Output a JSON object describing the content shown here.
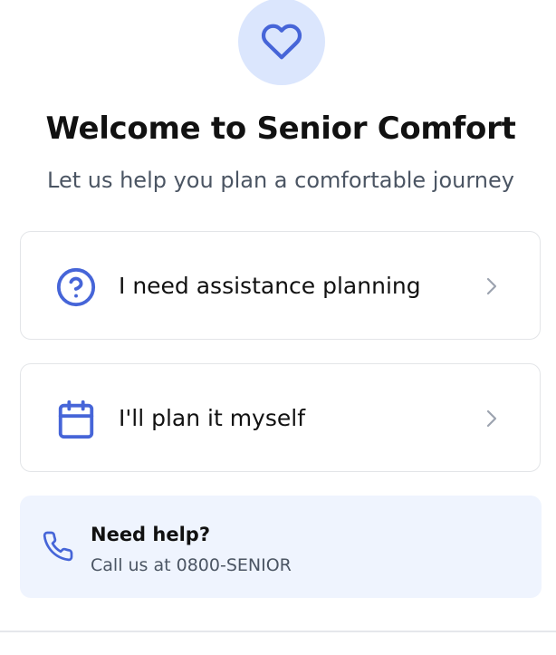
{
  "header": {
    "icon": "heart-icon",
    "title": "Welcome to Senior Comfort",
    "subtitle": "Let us help you plan a comfortable journey"
  },
  "options": [
    {
      "icon": "question-circle-icon",
      "label": "I need assistance planning",
      "chevron": "chevron-right-icon"
    },
    {
      "icon": "calendar-icon",
      "label": "I'll plan it myself",
      "chevron": "chevron-right-icon"
    }
  ],
  "help": {
    "icon": "phone-icon",
    "title": "Need help?",
    "text": "Call us at 0800-SENIOR"
  },
  "colors": {
    "accent": "#4665d8",
    "badge_bg": "#dbe6fd",
    "help_bg": "#eff4fe",
    "chevron": "#9ca3af",
    "border": "#e3e5e8"
  }
}
